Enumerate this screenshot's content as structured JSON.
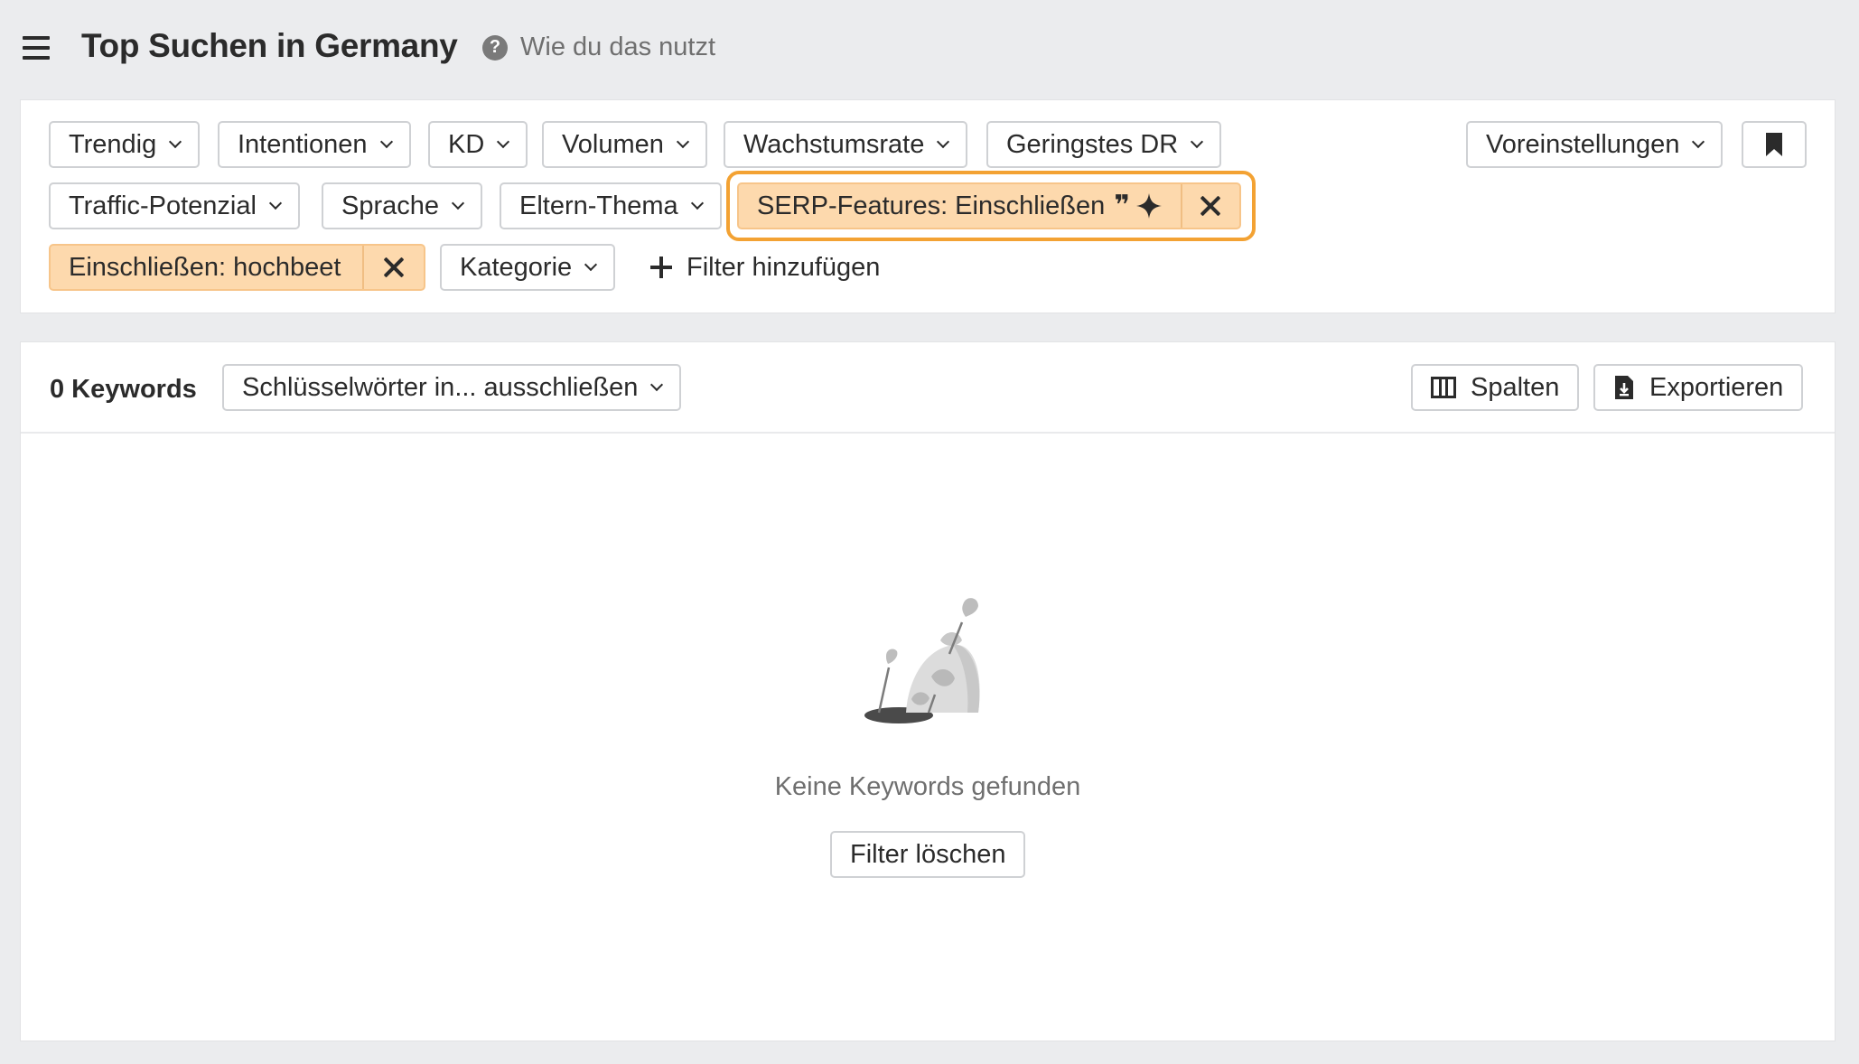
{
  "header": {
    "title": "Top Suchen in Germany",
    "help_label": "Wie du das nutzt",
    "help_icon_glyph": "?"
  },
  "filters": {
    "row1": [
      "Trendig",
      "Intentionen",
      "KD",
      "Volumen",
      "Wachstumsrate",
      "Geringstes DR"
    ],
    "row2": [
      "Traffic-Potenzial",
      "Sprache",
      "Eltern-Thema"
    ],
    "serp_active": "SERP-Features: Einschließen",
    "serp_quote_glyph": "❞",
    "include_active": "Einschließen: hochbeet",
    "category": "Kategorie",
    "add_filter": "Filter hinzufügen",
    "presets": "Voreinstellungen"
  },
  "results": {
    "count_label": "0 Keywords",
    "exclude_dropdown": "Schlüsselwörter in... ausschließen",
    "columns_button": "Spalten",
    "export_button": "Exportieren",
    "empty_message": "Keine Keywords gefunden",
    "clear_filters": "Filter löschen"
  },
  "colors": {
    "active_chip": "#fdd9ad",
    "highlight_ring": "#f3a233",
    "background": "#ebecee"
  },
  "icons": [
    "menu-icon",
    "help-icon",
    "chevron-down-icon",
    "close-icon",
    "quote-icon",
    "sparkle-icon",
    "bookmark-icon",
    "plus-icon",
    "columns-icon",
    "export-icon"
  ]
}
